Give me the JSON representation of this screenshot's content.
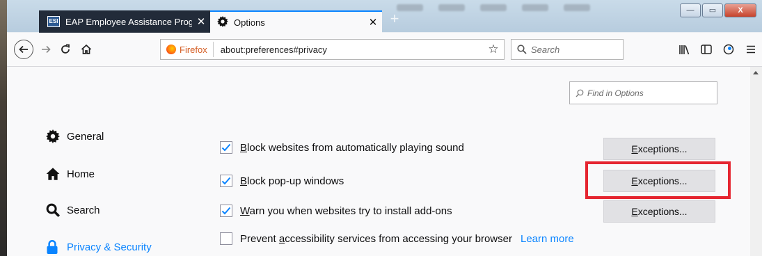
{
  "window": {
    "tabs": [
      {
        "favicon_text": "ESI",
        "title": "EAP Employee Assistance Progr",
        "close": "✕"
      },
      {
        "title": "Options",
        "close": "✕"
      }
    ],
    "controls": {
      "minimize": "—",
      "maximize": "▭",
      "close": "X"
    }
  },
  "navbar": {
    "identity_label": "Firefox",
    "url": "about:preferences#privacy",
    "search_placeholder": "Search"
  },
  "page": {
    "find_placeholder": "Find in Options",
    "categories": [
      {
        "icon": "gear-icon",
        "label": "General"
      },
      {
        "icon": "home-icon",
        "label": "Home"
      },
      {
        "icon": "search-icon",
        "label": "Search"
      },
      {
        "icon": "lock-icon",
        "label": "Privacy & Security",
        "selected": true
      }
    ],
    "prefs": [
      {
        "checked": true,
        "accesskey": "B",
        "rest": "lock websites from automatically playing sound",
        "button": {
          "accesskey": "E",
          "rest": "xceptions..."
        }
      },
      {
        "checked": true,
        "accesskey": "B",
        "rest": "lock pop-up windows",
        "button": {
          "accesskey": "E",
          "rest": "xceptions..."
        }
      },
      {
        "checked": true,
        "accesskey": "W",
        "rest": "arn you when websites try to install add-ons",
        "button": {
          "accesskey": "E",
          "rest": "xceptions..."
        }
      },
      {
        "checked": false,
        "pre": "Prevent ",
        "accesskey": "a",
        "rest": "ccessibility services from accessing your browser",
        "learn_more": "Learn more"
      }
    ]
  },
  "colors": {
    "accent": "#0a84ff",
    "highlight": "#e52530",
    "active_tab_bg": "#222b39"
  }
}
